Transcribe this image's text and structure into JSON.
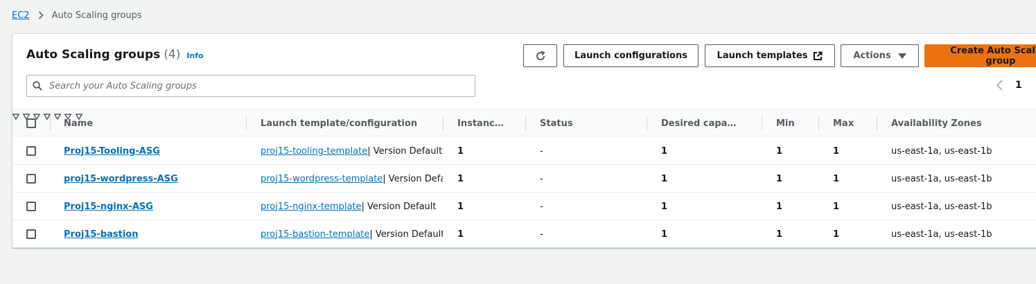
{
  "breadcrumb": {
    "root": "EC2",
    "current": "Auto Scaling groups"
  },
  "panel": {
    "title": "Auto Scaling groups",
    "count": "(4)",
    "info": "Info"
  },
  "toolbar": {
    "launch_configurations": "Launch configurations",
    "launch_templates": "Launch templates",
    "actions": "Actions",
    "create": "Create Auto Scaling group"
  },
  "search": {
    "placeholder": "Search your Auto Scaling groups",
    "value": ""
  },
  "pagination": {
    "current_page": "1"
  },
  "table": {
    "columns": {
      "name": "Name",
      "launch": "Launch template/configuration",
      "instances": "Instances",
      "status": "Status",
      "desired": "Desired capacity",
      "min": "Min",
      "max": "Max",
      "az": "Availability Zones"
    },
    "rows": [
      {
        "name": "Proj15-Tooling-ASG",
        "template": "proj15-tooling-template",
        "version": " | Version Default",
        "instances": "1",
        "status": "-",
        "desired": "1",
        "min": "1",
        "max": "1",
        "az": "us-east-1a, us-east-1b"
      },
      {
        "name": "proj15-wordpress-ASG",
        "template": "proj15-wordpress-template",
        "version": " | Version Default",
        "instances": "1",
        "status": "-",
        "desired": "1",
        "min": "1",
        "max": "1",
        "az": "us-east-1a, us-east-1b"
      },
      {
        "name": "Proj15-nginx-ASG",
        "template": "proj15-nginx-template",
        "version": " | Version Default",
        "instances": "1",
        "status": "-",
        "desired": "1",
        "min": "1",
        "max": "1",
        "az": "us-east-1a, us-east-1b"
      },
      {
        "name": "Proj15-bastion",
        "template": "proj15-bastion-template",
        "version": " | Version Default",
        "instances": "1",
        "status": "-",
        "desired": "1",
        "min": "1",
        "max": "1",
        "az": "us-east-1a, us-east-1b"
      }
    ]
  },
  "colors": {
    "link": "#0073bb",
    "primary": "#ec7211",
    "border": "#d5dbdb",
    "background": "#f2f3f3"
  }
}
